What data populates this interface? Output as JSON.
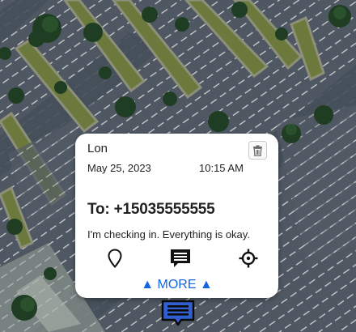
{
  "popup": {
    "sender": "Lon",
    "date": "May 25, 2023",
    "time": "10:15 AM",
    "to_line": "To: +15035555555",
    "message": "I'm checking in. Everything is okay.",
    "more_label": "▲ MORE ▲"
  },
  "icons": {
    "delete": "trash-icon",
    "location": "map-pin-icon",
    "reply": "message-icon",
    "locate": "crosshair-icon",
    "marker": "message-marker-icon"
  },
  "colors": {
    "accent": "#1565e0",
    "marker_fill": "#2f5fd0",
    "card": "#ffffff"
  }
}
